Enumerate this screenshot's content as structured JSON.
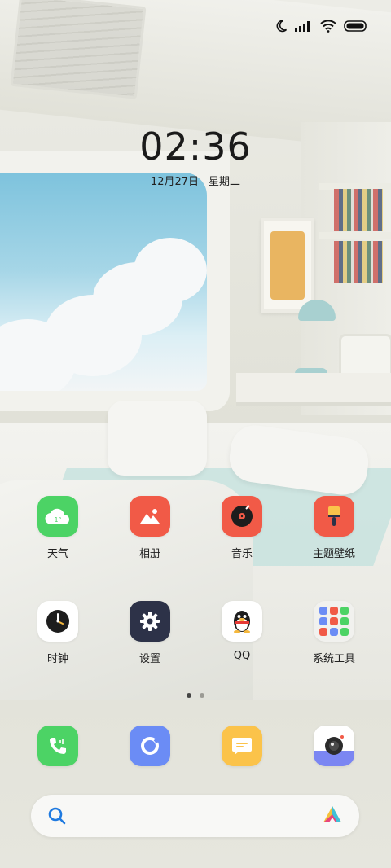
{
  "status_bar": {
    "icons": [
      "moon-icon",
      "signal-icon",
      "wifi-icon",
      "battery-icon"
    ]
  },
  "lock_clock": {
    "time": "02:36",
    "date": "12月27日",
    "weekday": "星期二"
  },
  "apps": [
    {
      "id": "weather",
      "label": "天气",
      "icon": "weather-cloud-icon",
      "color": "#4cd365",
      "badge": "1°"
    },
    {
      "id": "gallery",
      "label": "相册",
      "icon": "photo-icon",
      "color": "#f15a47"
    },
    {
      "id": "music",
      "label": "音乐",
      "icon": "vinyl-icon",
      "color": "#f15a47"
    },
    {
      "id": "themes",
      "label": "主题壁纸",
      "icon": "paintbrush-icon",
      "color": "#f15a47"
    },
    {
      "id": "clock",
      "label": "时钟",
      "icon": "clock-icon",
      "color": "#ffffff"
    },
    {
      "id": "settings",
      "label": "设置",
      "icon": "gear-icon",
      "color": "#2d3248"
    },
    {
      "id": "qq",
      "label": "QQ",
      "icon": "penguin-icon",
      "color": "#ffffff"
    },
    {
      "id": "tools",
      "label": "系统工具",
      "icon": "folder-icon",
      "color": "#f1f1ee"
    }
  ],
  "page_indicator": {
    "count": 2,
    "active": 0
  },
  "dock": [
    {
      "id": "phone",
      "icon": "phone-icon",
      "color": "#4cd365"
    },
    {
      "id": "browser",
      "icon": "ring-icon",
      "color": "#6b8cf5"
    },
    {
      "id": "messages",
      "icon": "message-icon",
      "color": "#fbc34a"
    },
    {
      "id": "camera",
      "icon": "camera-icon",
      "color": "#ffffff"
    }
  ],
  "search_bar": {
    "left_icon": "search-icon",
    "right_icon": "assistant-icon"
  }
}
